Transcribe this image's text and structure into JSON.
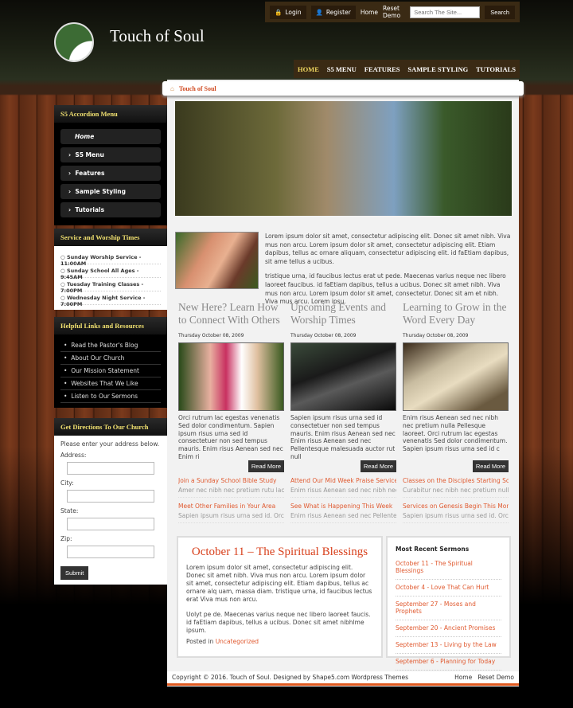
{
  "topbar": {
    "login": "Login",
    "register": "Register",
    "home": "Home",
    "reset": "Reset Demo",
    "search_placeholder": "Search The Site...",
    "search_btn": "Search"
  },
  "site_title": "Touch of Soul",
  "nav": [
    "HOME",
    "S5 MENU",
    "FEATURES",
    "SAMPLE STYLING",
    "TUTORIALS"
  ],
  "breadcrumb": "Touch of Soul",
  "sidebar": {
    "accordion_title": "S5 Accordion Menu",
    "accordion": [
      "Home",
      "S5 Menu",
      "Features",
      "Sample Styling",
      "Tutorials"
    ],
    "times_title": "Service and Worship Times",
    "times": [
      "Sunday Worship Service - 11:00AM",
      "Sunday School All Ages - 9:45AM",
      "Tuesday Training Classes - 7:00PM",
      "Wednesday Night Service - 7:00PM"
    ],
    "links_title": "Helpful Links and Resources",
    "links": [
      "Read the Pastor's Blog",
      "About Our Church",
      "Our Mission Statement",
      "Websites That We Like",
      "Listen to Our Sermons"
    ],
    "dir_title": "Get Directions To Our Church",
    "dir_intro": "Please enter your address below.",
    "fields": [
      "Address:",
      "City:",
      "State:",
      "Zip:"
    ],
    "submit": "Submit"
  },
  "intro": [
    "Lorem ipsum dolor sit amet, consectetur adipiscing elit. Donec sit amet nibh. Viva mus non arcu. Lorem ipsum dolor sit amet, consectetur adipiscing elit. Etiam dapibus, tellus ac ornare aliquam, consectetur adipiscing elit. id faEtiam dapibus, sit ame tellus a ucibus.",
    "tristique urna, id faucibus lectus erat ut pede. Maecenas varius neque nec libero laoreet faucibus. id faEtiam dapibus, tellus a ucibus. Donec sit amet nibh. Viva mus non arcu. Lorem ipsum dolor sit amet, consectetur. Donec sit am et nibh. Viva mus arcu. Lorem ipsu."
  ],
  "columns": [
    {
      "title": "New Here? Learn How to Connect With Others",
      "date": "Thursday October 08, 2009",
      "text": "Orci rutrum lac egestas venenatis Sed dolor condimentum. Sapien ipsum risus urna sed id consectetuer non sed tempus mauris. Enim risus Aenean sed nec Enim ri",
      "more": "Read More",
      "links": [
        {
          "t": "Join a Sunday School Bible Study",
          "s": "Amer nec nibh nec pretium rutu lac e"
        },
        {
          "t": "Meet Other Families in Your Area",
          "s": "Sapien ipsum risus urna sed id. Orci"
        }
      ]
    },
    {
      "title": "Upcoming Events and Worship Times",
      "date": "Thursday October 08, 2009",
      "text": "Sapien ipsum risus urna sed id consectetuer non sed tempus mauris. Enim risus Aenean sed nec Enim risus Aenean sed nec Pellentesque malesuada auctor rut null",
      "more": "Read More",
      "links": [
        {
          "t": "Attend Our Mid Week Praise Service",
          "s": "Enim risus Aenean sed nec nibh nec"
        },
        {
          "t": "See What is Happening This Week",
          "s": "Enim risus Aenean sed nec Pellentesq"
        }
      ]
    },
    {
      "title": "Learning to Grow in the Word Every Day",
      "date": "Thursday October 08, 2009",
      "text": "Enim risus Aenean sed nec nibh nec pretium nulla Pellesque laoreet. Orci rutrum lac egestas venenatis Sed dolor condimentum. Sapien ipsum risus urna sed id c",
      "more": "Read More",
      "links": [
        {
          "t": "Classes on the Disciples Starting Soon",
          "s": "Curabitur nec nibh nec pretium nulla"
        },
        {
          "t": "Services on Genesis Begin This Month",
          "s": "Sapien ipsum risus urna sed id. Orci"
        }
      ]
    }
  ],
  "post": {
    "title": "October 11 – The Spiritual Blessings",
    "p1": "Lorem ipsum dolor sit amet, consectetur adipiscing elit. Donec sit amet nibh. Viva mus non arcu. Lorem ipsum dolor sit amet, consectetur adipiscing elit. Etiam dapibus, tellus ac ornare alq uam, massa diam. tristique urna, id faucibus lectus erat Viva mus non arcu.",
    "p2": "Uolyt pe de. Maecenas varius neque nec libero laoreet faucis. id faEtiam dapibus, tellus a ucibus. Donec sit amet nibhlme ipsum.",
    "posted": "Posted in",
    "category": "Uncategorized"
  },
  "sermons": {
    "title": "Most Recent Sermons",
    "items": [
      "October 11 - The Spiritual Blessings",
      "October 4 - Love That Can Hurt",
      "September 27 - Moses and Prophets",
      "September 20 - Ancient Promises",
      "September 13 - Living by the Law",
      "September 6 - Planning for Today"
    ]
  },
  "footer": {
    "copyright": "Copyright © 2016. Touch of Soul. Designed by Shape5.com Wordpress Themes",
    "home": "Home",
    "reset": "Reset Demo"
  },
  "colors": {
    "accent": "#e05a30",
    "nav_active": "#f0d860",
    "header_bar": "#3a2a14"
  }
}
